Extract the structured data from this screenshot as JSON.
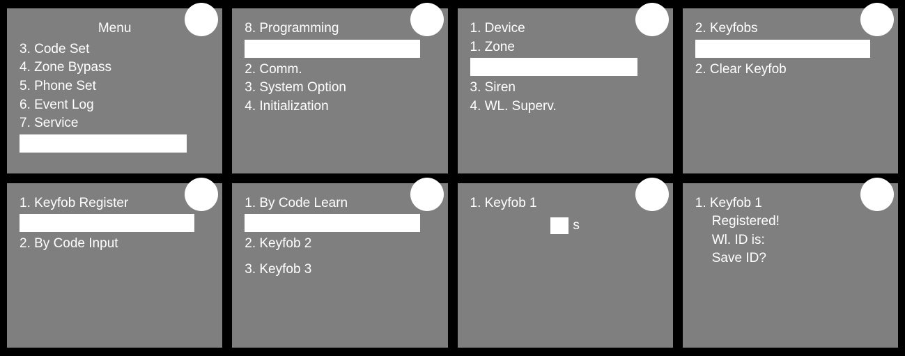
{
  "panels": [
    {
      "title": "Menu",
      "lines": [
        "3. Code Set",
        "4. Zone Bypass",
        "5. Phone Set",
        "6. Event Log",
        "7. Service"
      ]
    },
    {
      "lines": [
        "8. Programming",
        "",
        "2. Comm.",
        "3. System Option",
        "4. Initialization"
      ]
    },
    {
      "lines": [
        "1. Device",
        "1. Zone",
        "",
        "3. Siren",
        "4. WL. Superv."
      ]
    },
    {
      "lines": [
        "2. Keyfobs",
        "",
        "2. Clear Keyfob"
      ]
    },
    {
      "lines": [
        "1. Keyfob Register",
        "",
        "2. By Code Input"
      ]
    },
    {
      "lines": [
        "1. By Code Learn",
        "",
        "2. Keyfob 2",
        "",
        "3. Keyfob 3"
      ]
    },
    {
      "lines": [
        "1. Keyfob 1"
      ],
      "suffix": "s"
    },
    {
      "lines": [
        "1. Keyfob 1",
        "Registered!",
        "Wl. ID is:",
        "Save ID?"
      ]
    }
  ]
}
